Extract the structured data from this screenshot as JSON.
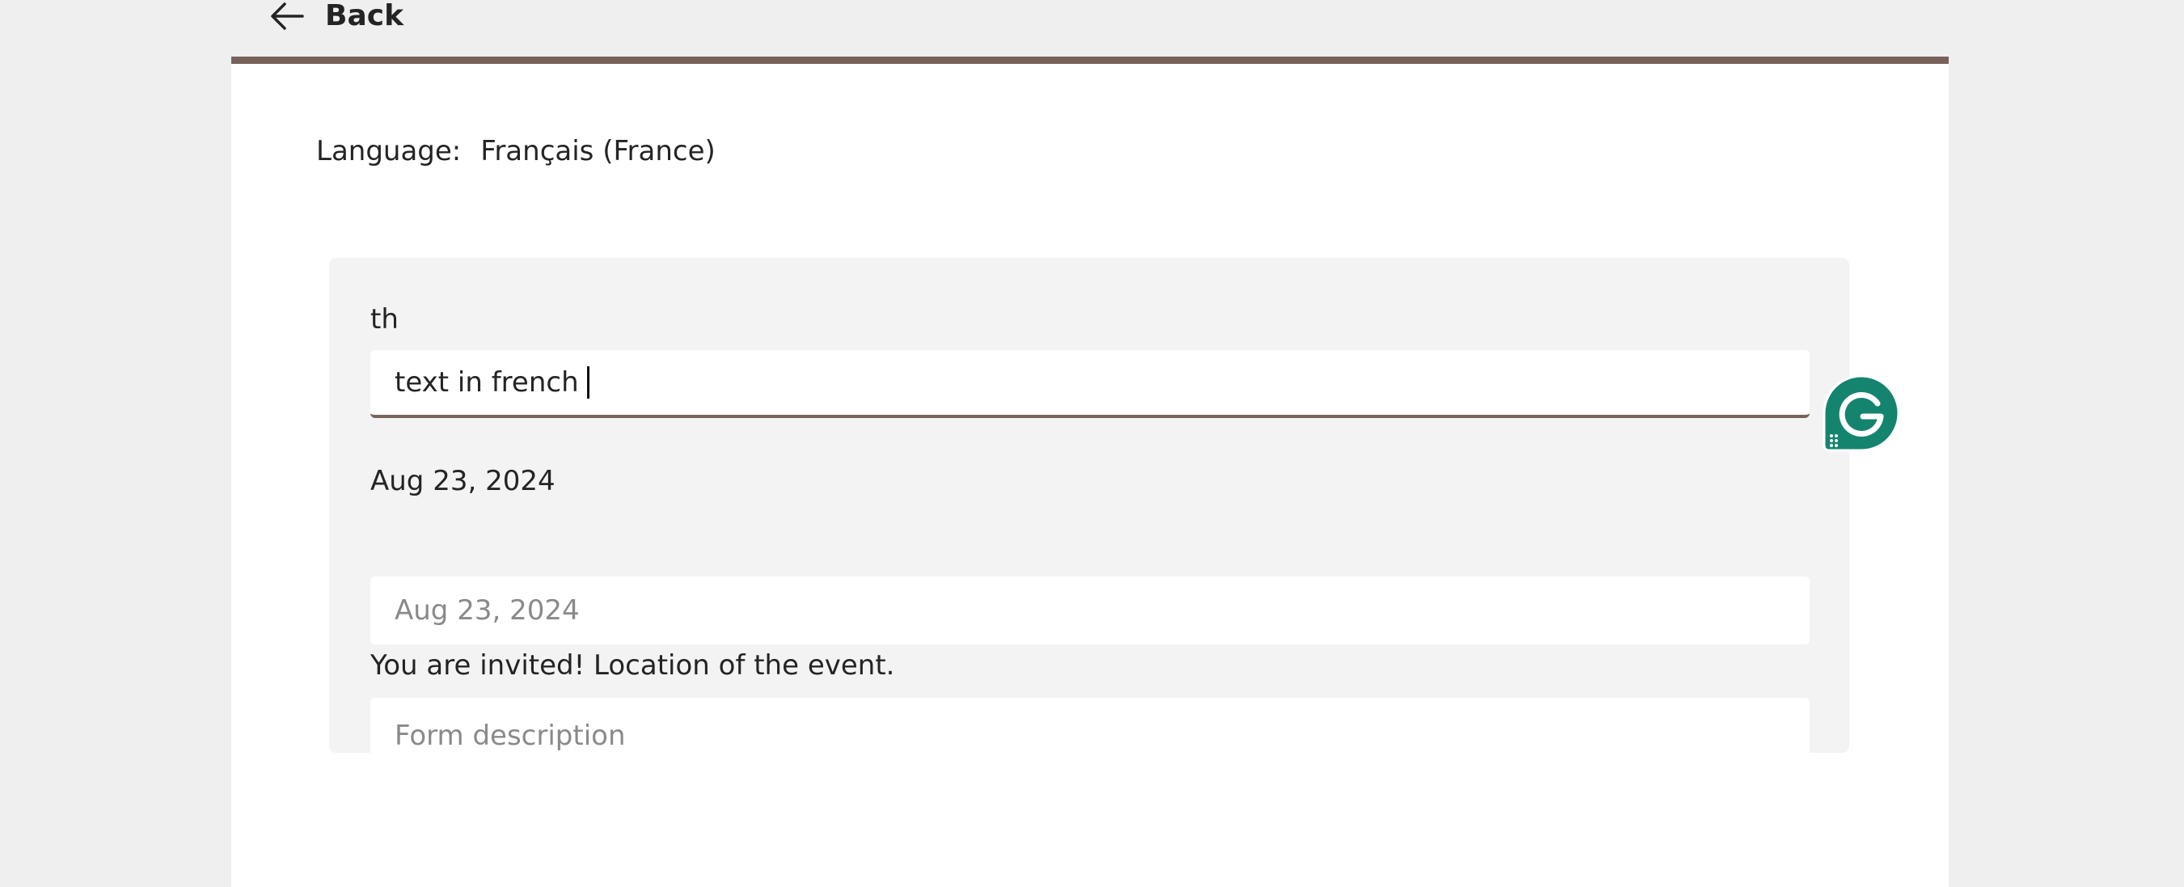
{
  "nav": {
    "back_label": "Back"
  },
  "language": {
    "label": "Language:",
    "value": "Français (France)"
  },
  "form": {
    "title_label": "th",
    "title_value": "text in french",
    "date_label": "Aug 23, 2024",
    "date_placeholder": "Aug 23, 2024",
    "description_label": "You are invited! Location of the event.",
    "description_placeholder": "Form description"
  },
  "colors": {
    "accent": "#77625a",
    "grammarly": "#15846f"
  },
  "icons": {
    "back": "arrow-left-icon",
    "grammarly": "grammarly-icon"
  }
}
